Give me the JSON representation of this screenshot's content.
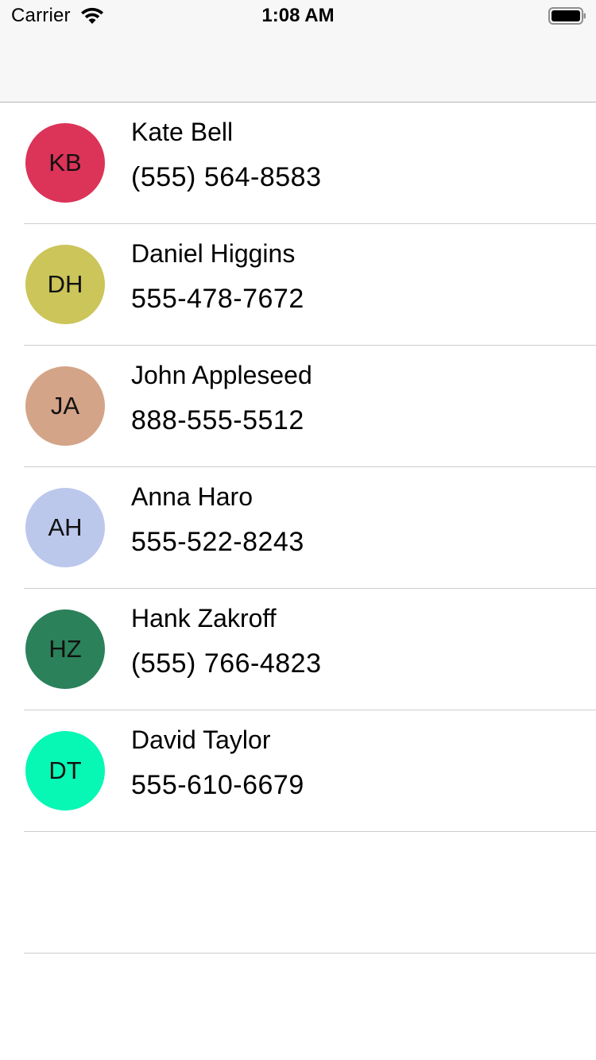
{
  "status_bar": {
    "carrier": "Carrier",
    "time": "1:08 AM",
    "icons": [
      "wifi-icon",
      "battery-icon"
    ]
  },
  "contacts": [
    {
      "initials": "KB",
      "name": "Kate Bell",
      "phone": "(555) 564-8583",
      "color": "#dc3358"
    },
    {
      "initials": "DH",
      "name": "Daniel Higgins",
      "phone": "555-478-7672",
      "color": "#cbc55a"
    },
    {
      "initials": "JA",
      "name": "John Appleseed",
      "phone": "888-555-5512",
      "color": "#d4a488"
    },
    {
      "initials": "AH",
      "name": "Anna Haro",
      "phone": "555-522-8243",
      "color": "#bcc7ec"
    },
    {
      "initials": "HZ",
      "name": "Hank Zakroff",
      "phone": "(555) 766-4823",
      "color": "#2b815a"
    },
    {
      "initials": "DT",
      "name": "David Taylor",
      "phone": "555-610-6679",
      "color": "#07f7b4"
    }
  ]
}
